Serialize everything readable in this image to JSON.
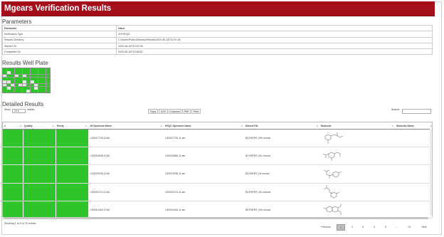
{
  "header": {
    "title": "Mgears Verification Results"
  },
  "parameters": {
    "heading": "Parameters",
    "col_param": "Parameter",
    "col_value": "Value",
    "rows": [
      {
        "name": "Verification Type",
        "value": "1H+HSQC"
      },
      {
        "name": "Results Directory",
        "value": "C:\\Users\\Public\\Desktop\\Results\\2020-06-18T10.57.08"
      },
      {
        "name": "Started On",
        "value": "2020-06-18T10:57:08"
      },
      {
        "name": "Completed On",
        "value": "2020-06-18T10:58:52"
      }
    ]
  },
  "plate": {
    "heading": "Results Well Plate",
    "colors": {
      "green": "#2fc52a",
      "grey": "#c8c8c8",
      "light": "#e6e6e6"
    }
  },
  "detailed": {
    "heading": "Detailed Results",
    "show_label": "Show",
    "show_value": "10",
    "entries_label": "entries",
    "buttons": [
      "Copy",
      "CSV",
      "Columns",
      "PDF",
      "Print"
    ],
    "search_label": "Search:",
    "columns": [
      "#",
      "Quality",
      "Purity",
      "1H Spectrum Name",
      "HSQC Spectrum Name",
      "Mnova File",
      "Molecule",
      "Molecule Name"
    ],
    "rows": [
      {
        "h1": "LS002/7730.10.fid",
        "hsqc": "LS002/7730.11.ser",
        "mnova": "B3-PAPER_00b.mnova"
      },
      {
        "h1": "LS003/3848.10.fid",
        "hsqc": "LS003/3848.11.ser",
        "mnova": "B2-PAPER_00c.mnova"
      },
      {
        "h1": "LS002/0036.10.fid",
        "hsqc": "LS002/0036.11.ser",
        "mnova": "B3-PAPER_04.mnova"
      },
      {
        "h1": "LS003/2174.10.fid",
        "hsqc": "LS003/2174.11.ser",
        "mnova": "B4-PAPER_00c.mnova"
      },
      {
        "h1": "LS003/1464.10.fid",
        "hsqc": "LS003/1464.11.ser",
        "mnova": "B5-PAPER_00b.mnova"
      }
    ],
    "footer_text": "Showing 1 to 6 of 75 entries",
    "pagination": [
      "Previous",
      "1",
      "2",
      "3",
      "4",
      "5",
      "...",
      "13",
      "Next"
    ]
  }
}
